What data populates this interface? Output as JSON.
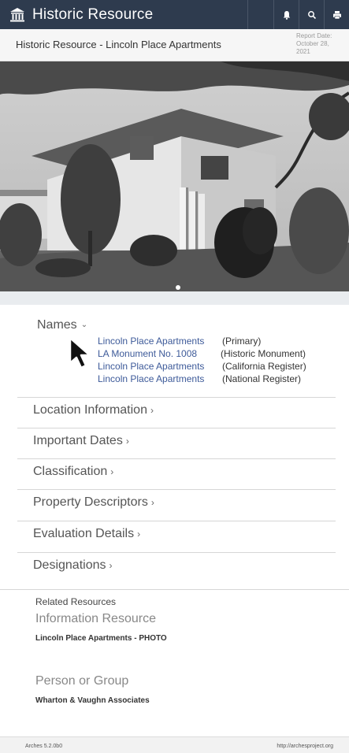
{
  "app": {
    "title": "Historic Resource",
    "brand_icon": "institution-icon",
    "toolbar_icons": [
      "bell-icon",
      "search-icon",
      "print-icon"
    ]
  },
  "header": {
    "resource_title": "Historic Resource - Lincoln Place Apartments",
    "report_date_label": "Report Date:",
    "report_date_line1": "October 28,",
    "report_date_line2": "2021"
  },
  "photo": {
    "description_icon": "building-photo",
    "carousel_active": 1
  },
  "names": {
    "label": "Names",
    "items": [
      {
        "name": "Lincoln Place Apartments",
        "type": "(Primary)"
      },
      {
        "name": "LA Monument No. 1008",
        "type": "(Historic Monument)"
      },
      {
        "name": "Lincoln Place Apartments",
        "type": "(California Register)"
      },
      {
        "name": "Lincoln Place Apartments",
        "type": "(National Register)"
      }
    ]
  },
  "sections": [
    {
      "label": "Location Information"
    },
    {
      "label": "Important Dates"
    },
    {
      "label": "Classification"
    },
    {
      "label": "Property Descriptors"
    },
    {
      "label": "Evaluation Details"
    },
    {
      "label": "Designations"
    }
  ],
  "related": {
    "title": "Related Resources",
    "groups": [
      {
        "type": "Information Resource",
        "item": "Lincoln Place Apartments - PHOTO"
      },
      {
        "type": "Person or Group",
        "item": "Wharton & Vaughn Associates"
      }
    ]
  },
  "footer": {
    "version": "Arches 5.2.0b0",
    "url": "http://archesproject.org"
  },
  "colors": {
    "topbar": "#2e3b4e",
    "link": "#3d5a99"
  }
}
